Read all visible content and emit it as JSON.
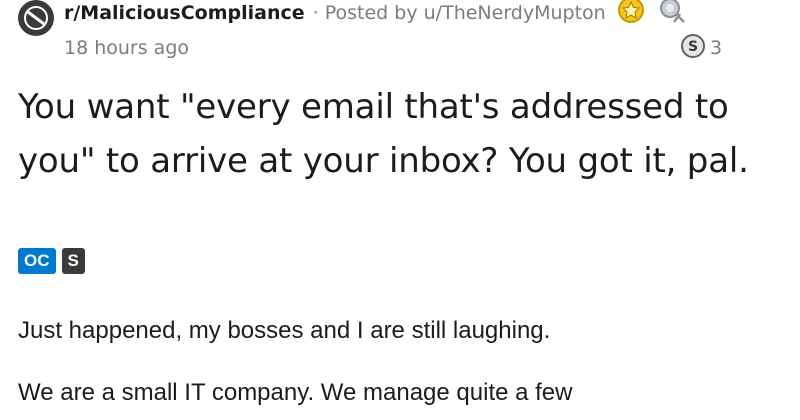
{
  "post": {
    "subreddit": "r/MaliciousCompliance",
    "posted_by_prefix": "· Posted by",
    "author": "u/TheNerdyMupton",
    "time": "18 hours ago",
    "award_count": "3",
    "title": "You want \"every email that's addressed to you\" to arrive at your inbox? You got it, pal.",
    "flairs": [
      "OC",
      "S"
    ],
    "body": [
      "Just happened, my bosses and I are still laughing.",
      "We are a small IT company. We manage quite a few"
    ]
  },
  "colors": {
    "flair_oc": "#0079d3",
    "flair_s": "#3a3a3a",
    "meta_text": "#7c7c7c",
    "text": "#1c1c1c"
  },
  "icons": [
    "subreddit-icon",
    "gold-award-icon",
    "silver-award-icon",
    "coin-award-icon"
  ]
}
